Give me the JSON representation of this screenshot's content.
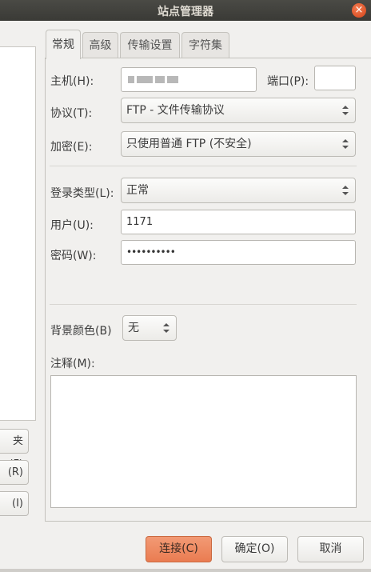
{
  "window": {
    "title": "站点管理器",
    "close_icon": "×"
  },
  "left_pane": {
    "buttons": [
      "夹(F)",
      "(R)",
      "(I)"
    ]
  },
  "tabs": [
    "常规",
    "高级",
    "传输设置",
    "字符集"
  ],
  "general": {
    "host_label": "主机(H):",
    "port_label": "端口(P):",
    "port_value": "",
    "protocol_label": "协议(T):",
    "protocol_value": "FTP - 文件传输协议",
    "encryption_label": "加密(E):",
    "encryption_value": "只使用普通 FTP (不安全)",
    "logon_type_label": "登录类型(L):",
    "logon_type_value": "正常",
    "user_label": "用户(U):",
    "user_value": "1171",
    "password_label": "密码(W):",
    "password_value": "••••••••••",
    "bg_color_label": "背景颜色(B)",
    "bg_color_value": "无",
    "comments_label": "注释(M):",
    "comments_value": ""
  },
  "footer": {
    "connect": "连接(C)",
    "ok": "确定(O)",
    "cancel": "取消"
  },
  "colors": {
    "accent": "#ea7c51",
    "titlebar": "#3c3b37"
  }
}
